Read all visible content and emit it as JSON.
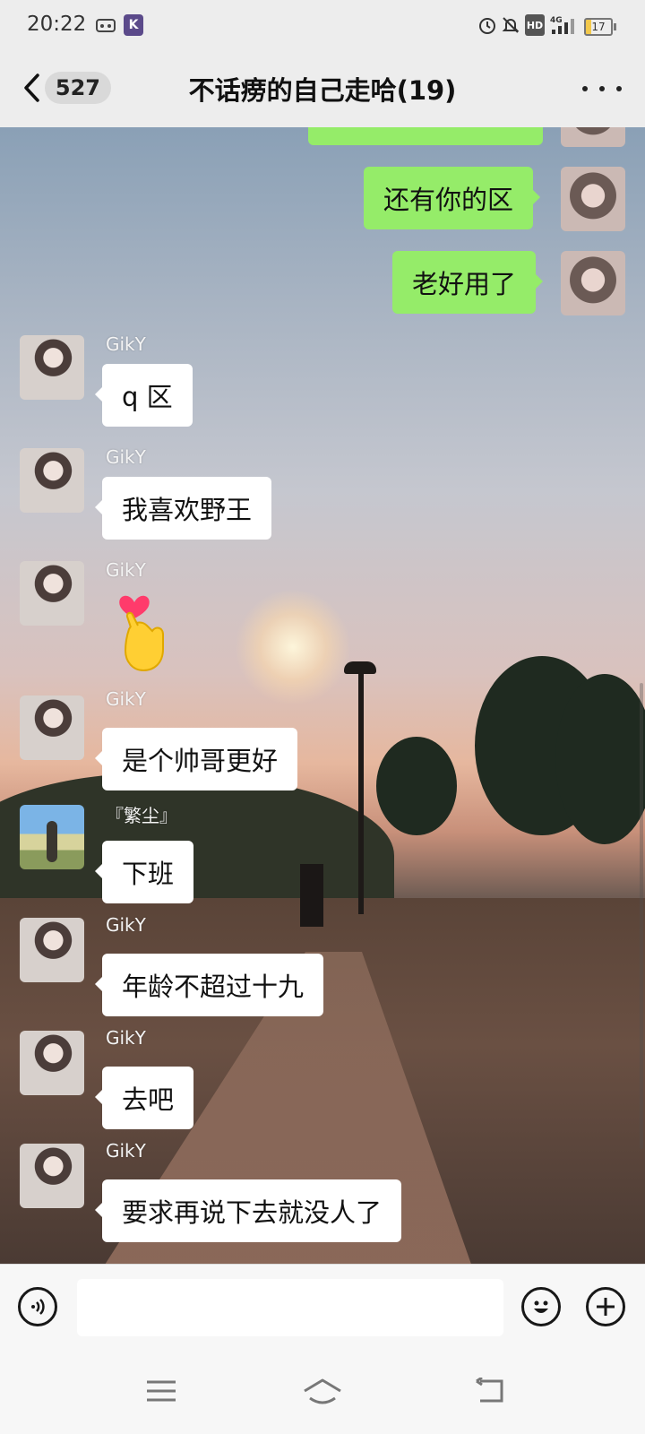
{
  "status_bar": {
    "time": "20:22",
    "network": "4G",
    "hd_label": "HD",
    "battery": "17",
    "icons": [
      "app-icon",
      "k-app-icon",
      "alarm-icon",
      "mute-icon",
      "hd-icon",
      "signal-icon",
      "battery-icon"
    ]
  },
  "nav": {
    "back_count": "527",
    "title": "不话痨的自己走哈(19)"
  },
  "messages": [
    {
      "side": "out",
      "text": "还有你的区"
    },
    {
      "side": "out",
      "text": "老好用了"
    },
    {
      "side": "in",
      "sender": "GikY",
      "text": "q 区"
    },
    {
      "side": "in",
      "sender": "GikY",
      "text": "我喜欢野王"
    },
    {
      "side": "in",
      "sender": "GikY",
      "sticker": "heart-hand-sticker"
    },
    {
      "side": "in",
      "sender": "GikY",
      "text": "是个帅哥更好"
    },
    {
      "side": "in",
      "sender": "『繁尘』",
      "text": "下班"
    },
    {
      "side": "in",
      "sender": "GikY",
      "text": "年龄不超过十九"
    },
    {
      "side": "in",
      "sender": "GikY",
      "text": "去吧"
    },
    {
      "side": "in",
      "sender": "GikY",
      "text": "要求再说下去就没人了"
    }
  ],
  "input": {
    "value": "",
    "placeholder": ""
  },
  "colors": {
    "outgoing_bubble": "#95ec69",
    "incoming_bubble": "#ffffff",
    "bar_background": "#ededed"
  }
}
